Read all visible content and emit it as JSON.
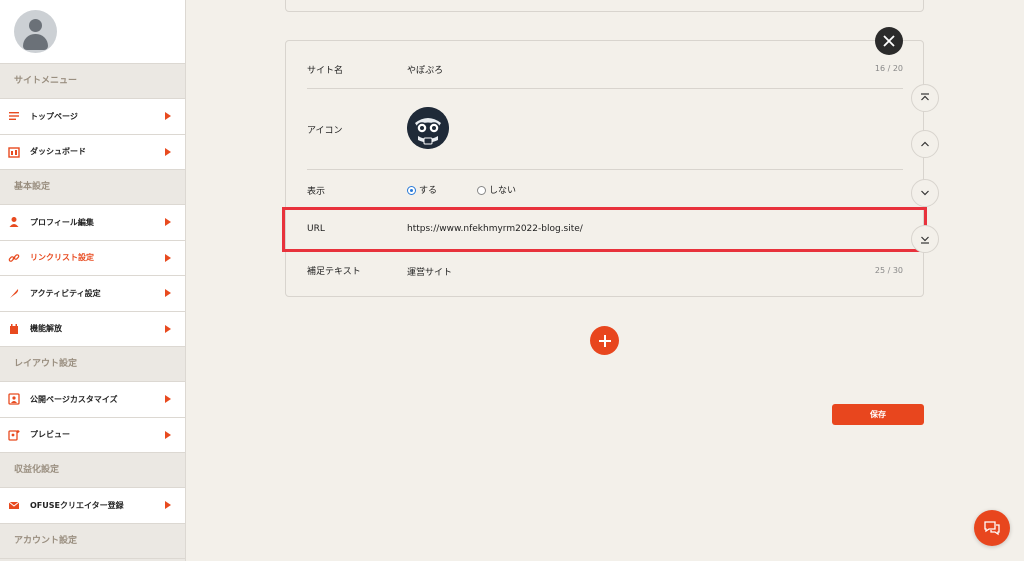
{
  "sidebar": {
    "sections": [
      {
        "title": "サイトメニュー",
        "items": [
          {
            "label": "トップページ",
            "icon": "list-icon"
          },
          {
            "label": "ダッシュボード",
            "icon": "dashboard-icon"
          }
        ]
      },
      {
        "title": "基本設定",
        "items": [
          {
            "label": "プロフィール編集",
            "icon": "person-icon"
          },
          {
            "label": "リンクリスト設定",
            "icon": "link-icon"
          },
          {
            "label": "アクティビティ設定",
            "icon": "quill-icon"
          },
          {
            "label": "機能解放",
            "icon": "unlock-icon"
          }
        ]
      },
      {
        "title": "レイアウト設定",
        "items": [
          {
            "label": "公開ページカスタマイズ",
            "icon": "customize-icon"
          },
          {
            "label": "プレビュー",
            "icon": "preview-icon"
          }
        ]
      },
      {
        "title": "収益化設定",
        "items": [
          {
            "label": "OFUSEクリエイター登録",
            "icon": "ofuse-icon"
          }
        ]
      },
      {
        "title": "アカウント設定",
        "items": []
      }
    ],
    "active_item": "リンクリスト設定"
  },
  "form": {
    "site_name": {
      "label": "サイト名",
      "value": "やぽぷろ",
      "count": "16 / 20"
    },
    "icon": {
      "label": "アイコン"
    },
    "display": {
      "label": "表示",
      "option_yes": "する",
      "option_no": "しない",
      "selected": "する"
    },
    "url": {
      "label": "URL",
      "value": "https://www.nfekhmyrm2022-blog.site/"
    },
    "supplement": {
      "label": "補足テキスト",
      "value": "運営サイト",
      "count": "25 / 30"
    }
  },
  "actions": {
    "save_label": "保存"
  },
  "colors": {
    "accent": "#e8461e",
    "highlight": "#e8323c",
    "background": "#f3f0ea"
  }
}
